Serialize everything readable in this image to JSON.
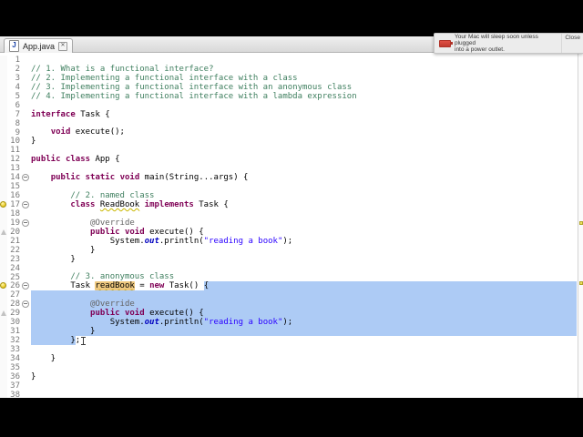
{
  "window": {
    "tab_title": "App.java"
  },
  "icons": {
    "java_file": "J",
    "tab_close": "✕"
  },
  "notification": {
    "message": "Your Mac will sleep soon unless plugged into a power outlet.",
    "line1": "Your Mac will sleep soon unless plugged",
    "line2": "into a power outlet.",
    "action": "Close"
  },
  "colors": {
    "selection": "#adcbf5",
    "occurrence": "#eec87f",
    "comment": "#3f7f5f",
    "keyword": "#7f0055",
    "string": "#2a00ff",
    "static_field": "#0000c0",
    "annotation": "#646464",
    "line_number": "#787878",
    "warning_marker": "#ece25e"
  },
  "editor": {
    "lines": [
      {
        "n": 1,
        "fold": false,
        "marker": null,
        "sel": false,
        "tokens": []
      },
      {
        "n": 2,
        "fold": false,
        "marker": null,
        "sel": false,
        "tokens": [
          [
            "c",
            "// 1. What is a functional interface?"
          ]
        ]
      },
      {
        "n": 3,
        "fold": false,
        "marker": null,
        "sel": false,
        "tokens": [
          [
            "c",
            "// 2. Implementing a functional interface with a class"
          ]
        ]
      },
      {
        "n": 4,
        "fold": false,
        "marker": null,
        "sel": false,
        "tokens": [
          [
            "c",
            "// 3. Implementing a functional interface with an anonymous class"
          ]
        ]
      },
      {
        "n": 5,
        "fold": false,
        "marker": null,
        "sel": false,
        "tokens": [
          [
            "c",
            "// 4. Implementing a functional interface with a lambda expression"
          ]
        ]
      },
      {
        "n": 6,
        "fold": false,
        "marker": null,
        "sel": false,
        "tokens": []
      },
      {
        "n": 7,
        "fold": false,
        "marker": null,
        "sel": false,
        "tokens": [
          [
            "k",
            "interface"
          ],
          [
            "p",
            " Task {"
          ]
        ]
      },
      {
        "n": 8,
        "fold": false,
        "marker": null,
        "sel": false,
        "tokens": []
      },
      {
        "n": 9,
        "fold": false,
        "marker": null,
        "sel": false,
        "tokens": [
          [
            "p",
            "    "
          ],
          [
            "k",
            "void"
          ],
          [
            "p",
            " execute();"
          ]
        ]
      },
      {
        "n": 10,
        "fold": false,
        "marker": null,
        "sel": false,
        "tokens": [
          [
            "p",
            "}"
          ]
        ]
      },
      {
        "n": 11,
        "fold": false,
        "marker": null,
        "sel": false,
        "tokens": []
      },
      {
        "n": 12,
        "fold": false,
        "marker": null,
        "sel": false,
        "tokens": [
          [
            "k",
            "public"
          ],
          [
            "p",
            " "
          ],
          [
            "k",
            "class"
          ],
          [
            "p",
            " App {"
          ]
        ]
      },
      {
        "n": 13,
        "fold": false,
        "marker": null,
        "sel": false,
        "tokens": []
      },
      {
        "n": 14,
        "fold": true,
        "marker": null,
        "sel": false,
        "tokens": [
          [
            "p",
            "    "
          ],
          [
            "k",
            "public"
          ],
          [
            "p",
            " "
          ],
          [
            "k",
            "static"
          ],
          [
            "p",
            " "
          ],
          [
            "k",
            "void"
          ],
          [
            "p",
            " main(String...args) {"
          ]
        ]
      },
      {
        "n": 15,
        "fold": false,
        "marker": null,
        "sel": false,
        "tokens": []
      },
      {
        "n": 16,
        "fold": false,
        "marker": null,
        "sel": false,
        "tokens": [
          [
            "c",
            "        // 2. named class"
          ]
        ]
      },
      {
        "n": 17,
        "fold": true,
        "marker": "bulb",
        "sel": false,
        "tokens": [
          [
            "p",
            "        "
          ],
          [
            "k",
            "class"
          ],
          [
            "p",
            " "
          ],
          [
            "w",
            "ReadBook"
          ],
          [
            "p",
            " "
          ],
          [
            "k",
            "implements"
          ],
          [
            "p",
            " Task {"
          ]
        ]
      },
      {
        "n": 18,
        "fold": false,
        "marker": null,
        "sel": false,
        "tokens": []
      },
      {
        "n": 19,
        "fold": true,
        "marker": null,
        "sel": false,
        "tokens": [
          [
            "p",
            "            "
          ],
          [
            "a",
            "@Override"
          ]
        ]
      },
      {
        "n": 20,
        "fold": false,
        "marker": "tri",
        "sel": false,
        "tokens": [
          [
            "p",
            "            "
          ],
          [
            "k",
            "public"
          ],
          [
            "p",
            " "
          ],
          [
            "k",
            "void"
          ],
          [
            "p",
            " execute() {"
          ]
        ]
      },
      {
        "n": 21,
        "fold": false,
        "marker": null,
        "sel": false,
        "tokens": [
          [
            "p",
            "                System."
          ],
          [
            "f",
            "out"
          ],
          [
            "p",
            ".println("
          ],
          [
            "s",
            "\"reading a book\""
          ],
          [
            "p",
            ");"
          ]
        ]
      },
      {
        "n": 22,
        "fold": false,
        "marker": null,
        "sel": false,
        "tokens": [
          [
            "p",
            "            }"
          ]
        ]
      },
      {
        "n": 23,
        "fold": false,
        "marker": null,
        "sel": false,
        "tokens": [
          [
            "p",
            "        }"
          ]
        ]
      },
      {
        "n": 24,
        "fold": false,
        "marker": null,
        "sel": false,
        "tokens": []
      },
      {
        "n": 25,
        "fold": false,
        "marker": null,
        "sel": false,
        "tokens": [
          [
            "c",
            "        // 3. anonymous class"
          ]
        ]
      },
      {
        "n": 26,
        "fold": true,
        "marker": "bulb",
        "sel": false,
        "tokens": [
          [
            "p",
            "        Task "
          ],
          [
            "o",
            "readBook"
          ],
          [
            "p",
            " = "
          ],
          [
            "k",
            "new"
          ],
          [
            "p",
            " Task() "
          ],
          [
            "x",
            "{"
          ]
        ]
      },
      {
        "n": 27,
        "fold": false,
        "marker": null,
        "sel": true,
        "tokens": []
      },
      {
        "n": 28,
        "fold": true,
        "marker": null,
        "sel": true,
        "tokens": [
          [
            "p",
            "            "
          ],
          [
            "a",
            "@Override"
          ]
        ]
      },
      {
        "n": 29,
        "fold": false,
        "marker": "tri",
        "sel": true,
        "tokens": [
          [
            "p",
            "            "
          ],
          [
            "k",
            "public"
          ],
          [
            "p",
            " "
          ],
          [
            "k",
            "void"
          ],
          [
            "p",
            " execute() {"
          ]
        ]
      },
      {
        "n": 30,
        "fold": false,
        "marker": null,
        "sel": true,
        "tokens": [
          [
            "p",
            "                System."
          ],
          [
            "f",
            "out"
          ],
          [
            "p",
            ".println("
          ],
          [
            "s",
            "\"reading a book\""
          ],
          [
            "p",
            ");"
          ]
        ]
      },
      {
        "n": 31,
        "fold": false,
        "marker": null,
        "sel": true,
        "tokens": [
          [
            "p",
            "            }"
          ]
        ]
      },
      {
        "n": 32,
        "fold": false,
        "marker": null,
        "sel": false,
        "tokens": [
          [
            "y",
            "        }"
          ],
          [
            "p",
            ";"
          ],
          [
            "caret",
            ""
          ]
        ]
      },
      {
        "n": 33,
        "fold": false,
        "marker": null,
        "sel": false,
        "tokens": []
      },
      {
        "n": 34,
        "fold": false,
        "marker": null,
        "sel": false,
        "tokens": [
          [
            "p",
            "    }"
          ]
        ]
      },
      {
        "n": 35,
        "fold": false,
        "marker": null,
        "sel": false,
        "tokens": []
      },
      {
        "n": 36,
        "fold": false,
        "marker": null,
        "sel": false,
        "tokens": [
          [
            "p",
            "}"
          ]
        ]
      },
      {
        "n": 37,
        "fold": false,
        "marker": null,
        "sel": false,
        "tokens": []
      },
      {
        "n": 38,
        "fold": false,
        "marker": null,
        "sel": false,
        "tokens": []
      }
    ]
  }
}
